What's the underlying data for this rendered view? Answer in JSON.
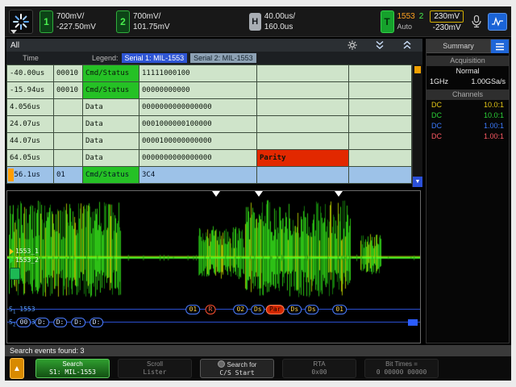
{
  "topbar": {
    "ch1": {
      "num": "1",
      "vdiv": "700mV/",
      "offset": "-227.50mV"
    },
    "ch2": {
      "num": "2",
      "vdiv": "700mV/",
      "offset": "101.75mV"
    },
    "horiz": {
      "badge": "H",
      "tdiv": "40.00us/",
      "delay": "160.0us"
    },
    "trig": {
      "badge": "T",
      "bus": "1553",
      "src": "2",
      "mode": "Auto",
      "level_high": "230mV",
      "level_low": "-230mV"
    }
  },
  "icons": {
    "logo": "spinner-icon",
    "microphone": "mic-icon",
    "touch_badge": "waveform-badge-icon",
    "settings": "gear-icon",
    "collapse": "chevron-double-down-icon",
    "expand": "chevron-double-up-icon",
    "summary_list": "list-icon",
    "scroll_down": "triangle-down-icon",
    "back": "arrow-up-icon"
  },
  "lister": {
    "title": "All",
    "time_header": "Time",
    "legend": "Legend:",
    "serial1_chip": "Serial 1: MIL-1553",
    "serial2_chip": "Serial 2: MIL-1553",
    "rows": [
      {
        "time": "-40.00us",
        "rta": "00010",
        "type": "Cmd/Status",
        "data": "11111000100",
        "error": "",
        "state": "normal"
      },
      {
        "time": "-15.94us",
        "rta": "00010",
        "type": "Cmd/Status",
        "data": "00000000000",
        "error": "",
        "state": "normal"
      },
      {
        "time": "4.056us",
        "rta": "",
        "type": "Data",
        "data": "0000000000000000",
        "error": "",
        "state": "normal"
      },
      {
        "time": "24.07us",
        "rta": "",
        "type": "Data",
        "data": "0001000000100000",
        "error": "",
        "state": "normal"
      },
      {
        "time": "44.07us",
        "rta": "",
        "type": "Data",
        "data": "0000100000000000",
        "error": "",
        "state": "normal"
      },
      {
        "time": "64.05us",
        "rta": "",
        "type": "Data",
        "data": "0000000000000000",
        "error": "Parity",
        "state": "error"
      },
      {
        "time": "156.1us",
        "rta": "01",
        "type": "Cmd/Status",
        "data": "3C4",
        "error": "",
        "state": "selected"
      }
    ]
  },
  "sidebar": {
    "tab": "Summary",
    "acquisition_title": "Acquisition",
    "acq_mode": "Normal",
    "bandwidth": "1GHz",
    "sample_rate": "1.00GSa/s",
    "channels_title": "Channels",
    "channels": [
      {
        "coupling": "DC",
        "probe": "10.0:1",
        "color": "#e6c817"
      },
      {
        "coupling": "DC",
        "probe": "10.0:1",
        "color": "#2bd237"
      },
      {
        "coupling": "DC",
        "probe": "1.00:1",
        "color": "#3b7bff"
      },
      {
        "coupling": "DC",
        "probe": "1.00:1",
        "color": "#ff5a64"
      }
    ]
  },
  "waveform": {
    "bus_labels": [
      "1553_1",
      "1553_2"
    ],
    "markers_x": [
      50.5,
      61.0,
      80.2
    ],
    "serial1": {
      "prefix": "S",
      "sub": "1",
      "name": "1553",
      "bubbles": [
        {
          "t": "01",
          "x": 45.0
        },
        {
          "t": "R",
          "x": 49.2,
          "style": "alert"
        },
        {
          "t": "02",
          "x": 56.5
        },
        {
          "t": "Ds",
          "x": 60.7
        },
        {
          "t": "Par",
          "x": 64.9,
          "style": "error"
        },
        {
          "t": "Ds",
          "x": 69.6
        },
        {
          "t": "Ds",
          "x": 73.8
        },
        {
          "t": "01",
          "x": 80.5
        }
      ]
    },
    "serial2": {
      "prefix": "S",
      "sub": "2",
      "name": "1553",
      "bubbles": [
        {
          "t": "00",
          "x": 4.0
        },
        {
          "t": "D:",
          "x": 8.4
        },
        {
          "t": "D:",
          "x": 12.8
        },
        {
          "t": "D:",
          "x": 17.2
        },
        {
          "t": "D:",
          "x": 21.6
        }
      ]
    }
  },
  "status": "Search events found: 3",
  "softkeys": [
    {
      "line1": "Search",
      "line2": "S1: MIL-1553",
      "style": "active"
    },
    {
      "line1": "Scroll",
      "line2": "Lister",
      "style": "dim"
    },
    {
      "line1": "Search for",
      "line2": "C/S Start",
      "style": "normal",
      "icon": "circle"
    },
    {
      "line1": "RTA",
      "line2": "0x00",
      "style": "dim"
    },
    {
      "line1": "Bit Times =",
      "line2": "0 00000 00000",
      "style": "dim"
    }
  ],
  "colors": {
    "accent_green": "#25c125",
    "selected_blue": "#9dc2e8",
    "error_red": "#e22800",
    "marker_orange": "#ff9e00"
  }
}
